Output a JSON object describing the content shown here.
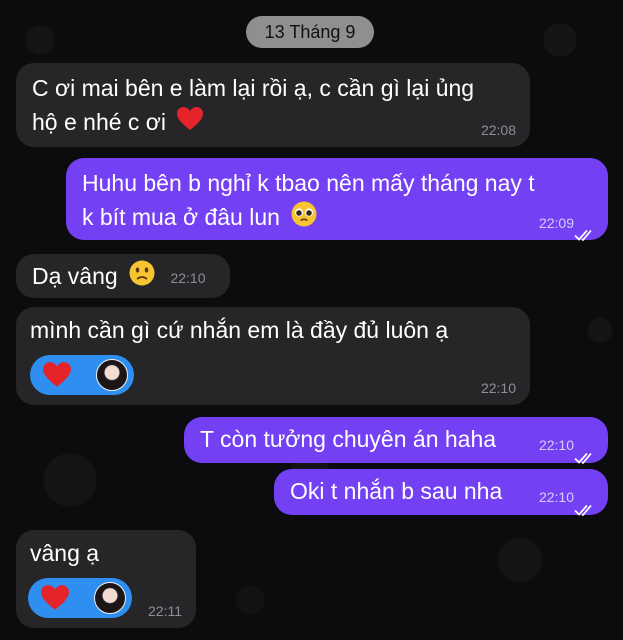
{
  "chat": {
    "date_divider": "13 Tháng 9",
    "messages": [
      {
        "direction": "incoming",
        "text_line1": "C ơi mai bên e làm lại rồi ạ, c cần gì lại ủng",
        "text_line2": "hộ e nhé c ơi",
        "emoji": "red-heart",
        "time": "22:08"
      },
      {
        "direction": "outgoing",
        "text_line1": "Huhu bên b nghỉ k tbao nên mấy tháng nay t",
        "text_line2": "k bít mua ở đâu lun",
        "emoji": "pleading-face",
        "time": "22:09",
        "status": "read"
      },
      {
        "direction": "incoming",
        "text": "Dạ vâng",
        "emoji": "slightly-frowning-face",
        "time": "22:10"
      },
      {
        "direction": "incoming",
        "text": "mình cần gì cứ nhắn em là đầy đủ luôn ạ",
        "reaction": "red-heart",
        "reaction_by": "avatar",
        "time": "22:10"
      },
      {
        "direction": "outgoing",
        "text": "T còn tưởng chuyên án haha",
        "time": "22:10",
        "status": "read"
      },
      {
        "direction": "outgoing",
        "text": "Oki t nhắn b sau nha",
        "time": "22:10",
        "status": "read"
      },
      {
        "direction": "incoming",
        "text": "vâng ạ",
        "reaction": "red-heart",
        "reaction_by": "avatar",
        "time": "22:11"
      }
    ]
  },
  "colors": {
    "incoming_bubble": "#262628",
    "outgoing_bubble": "#7440f4",
    "reaction_pill": "#2f8ff1",
    "date_pill": "#8f8f92",
    "heart": "#e4232b"
  }
}
